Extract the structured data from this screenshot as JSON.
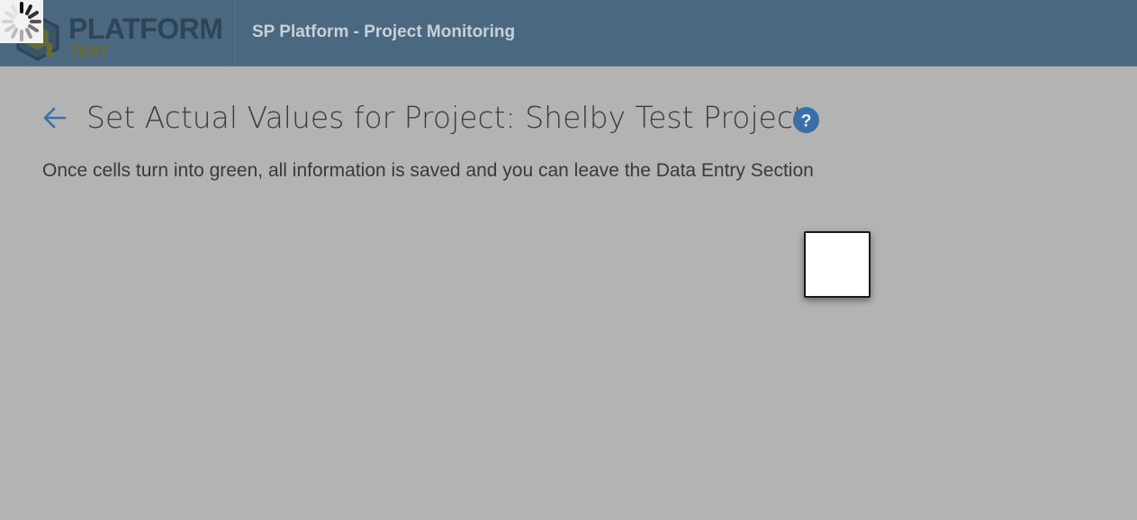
{
  "header": {
    "logo_word": "PLATFORM",
    "logo_sub": "TEST",
    "app_title": "SP Platform - Project Monitoring"
  },
  "page": {
    "title": "Set Actual Values for Project: Shelby Test Project",
    "subtitle": "Once cells turn into green, all information is saved and you can leave the Data Entry Section"
  },
  "icons": {
    "back": "arrow-left-icon",
    "help": "question-circle-icon",
    "spinner": "loading-spinner-icon",
    "logo": "platform-logo-icon"
  },
  "colors": {
    "header_bg": "#4a6880",
    "overlay_bg": "#b3b3b3",
    "accent_blue": "#3a6fa8",
    "logo_sub": "#6d6a2c"
  }
}
